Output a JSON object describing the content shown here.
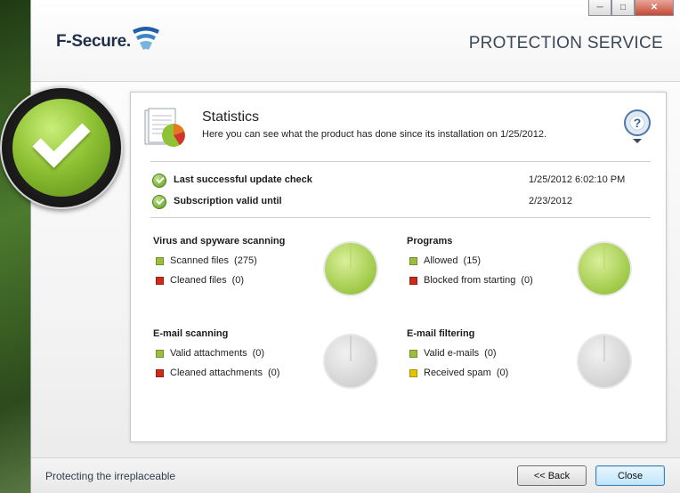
{
  "window": {
    "brand": "F-Secure.",
    "service_title": "PROTECTION SERVICE",
    "controls": {
      "minimize_icon": "minimize-icon",
      "maximize_icon": "maximize-icon",
      "close_icon": "close-icon"
    }
  },
  "statistics": {
    "title": "Statistics",
    "subtitle": "Here you can see what the product has done since its installation on 1/25/2012."
  },
  "info_rows": [
    {
      "label": "Last successful update check",
      "value": "1/25/2012 6:02:10 PM"
    },
    {
      "label": "Subscription valid until",
      "value": "2/23/2012"
    }
  ],
  "groups": {
    "virus": {
      "title": "Virus and spyware scanning",
      "items": [
        {
          "label": "Scanned files",
          "count": "(275)",
          "color": "#9bbf3a"
        },
        {
          "label": "Cleaned files",
          "count": "(0)",
          "color": "#cc2a1a"
        }
      ],
      "pie_state": "active"
    },
    "programs": {
      "title": "Programs",
      "items": [
        {
          "label": "Allowed",
          "count": "(15)",
          "color": "#9bbf3a"
        },
        {
          "label": "Blocked from starting",
          "count": "(0)",
          "color": "#cc2a1a"
        }
      ],
      "pie_state": "active"
    },
    "email_scanning": {
      "title": "E-mail scanning",
      "items": [
        {
          "label": "Valid attachments",
          "count": "(0)",
          "color": "#9bbf3a"
        },
        {
          "label": "Cleaned attachments",
          "count": "(0)",
          "color": "#cc2a1a"
        }
      ],
      "pie_state": "empty"
    },
    "email_filtering": {
      "title": "E-mail filtering",
      "items": [
        {
          "label": "Valid e-mails",
          "count": "(0)",
          "color": "#9bbf3a"
        },
        {
          "label": "Received spam",
          "count": "(0)",
          "color": "#e6c200"
        }
      ],
      "pie_state": "empty"
    }
  },
  "footer": {
    "tagline": "Protecting the irreplaceable",
    "back_label": "<< Back",
    "close_label": "Close"
  },
  "colors": {
    "accent_green": "#8fc234",
    "empty_gray": "#d9d9d9"
  }
}
